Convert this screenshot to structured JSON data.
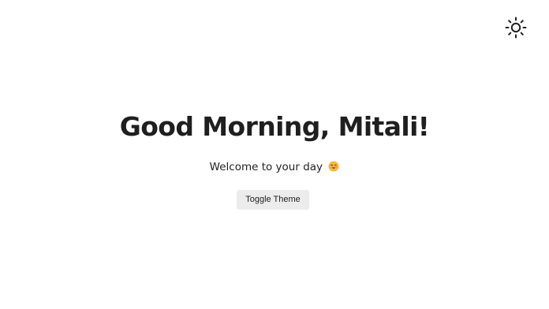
{
  "header": {
    "theme_icon": "sun-icon"
  },
  "main": {
    "greeting": "Good Morning, Mitali!",
    "subtitle": "Welcome to your day",
    "subtitle_emoji": "smiling-face-emoji",
    "toggle_label": "Toggle Theme"
  },
  "colors": {
    "background": "#ffffff",
    "text": "#1f1f1f",
    "button_bg": "#ececec",
    "emoji_face": "#f6b93b",
    "emoji_cheek": "#f08a7a"
  }
}
